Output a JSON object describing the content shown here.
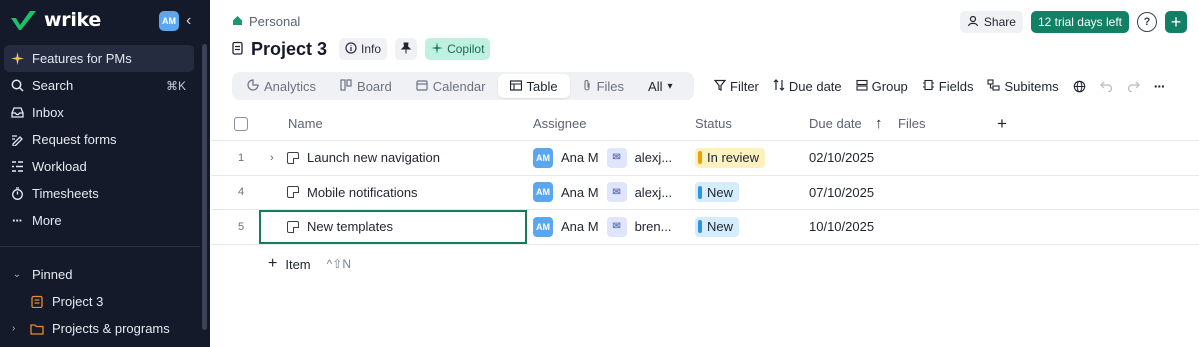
{
  "app": {
    "logo_text": "wrike",
    "user_initials": "AM"
  },
  "sidebar": {
    "items": [
      {
        "label": "Features for PMs",
        "icon": "sparkle-icon"
      },
      {
        "label": "Search",
        "icon": "search-icon",
        "shortcut": "⌘K"
      },
      {
        "label": "Inbox",
        "icon": "inbox-icon"
      },
      {
        "label": "Request forms",
        "icon": "form-icon"
      },
      {
        "label": "Workload",
        "icon": "workload-icon"
      },
      {
        "label": "Timesheets",
        "icon": "timer-icon"
      },
      {
        "label": "More",
        "icon": "more-icon"
      }
    ],
    "pinned_label": "Pinned",
    "pinned": [
      {
        "label": "Project 3",
        "icon": "project-icon"
      },
      {
        "label": "Projects & programs",
        "icon": "folder-icon"
      }
    ]
  },
  "header": {
    "breadcrumb": "Personal",
    "title": "Project 3",
    "info_label": "Info",
    "copilot_label": "Copilot",
    "share_label": "Share",
    "trial_label": "12 trial days left",
    "help_label": "?"
  },
  "tabs": [
    {
      "label": "Analytics"
    },
    {
      "label": "Board"
    },
    {
      "label": "Calendar"
    },
    {
      "label": "Table"
    },
    {
      "label": "Files"
    },
    {
      "label": "All"
    }
  ],
  "toolbar": {
    "filter": "Filter",
    "due_date": "Due date",
    "group": "Group",
    "fields": "Fields",
    "subitems": "Subitems"
  },
  "table": {
    "columns": {
      "name": "Name",
      "assignee": "Assignee",
      "status": "Status",
      "due": "Due date",
      "files": "Files"
    },
    "rows": [
      {
        "num": "1",
        "name": "Launch new navigation",
        "assignee": "Ana M",
        "assignee_initials": "AM",
        "other": "alexj...",
        "status": "In review",
        "due": "02/10/2025"
      },
      {
        "num": "4",
        "name": "Mobile notifications",
        "assignee": "Ana M",
        "assignee_initials": "AM",
        "other": "alexj...",
        "status": "New",
        "due": "07/10/2025"
      },
      {
        "num": "5",
        "name": "New templates",
        "assignee": "Ana M",
        "assignee_initials": "AM",
        "other": "bren...",
        "status": "New",
        "due": "10/10/2025"
      }
    ],
    "add_item_label": "Item",
    "add_item_shortcut": "^⇧N"
  },
  "colors": {
    "brand": "#128065",
    "sidebar_bg": "#141a2a",
    "review": "#fcf1bf",
    "new": "#d4ecfb"
  }
}
